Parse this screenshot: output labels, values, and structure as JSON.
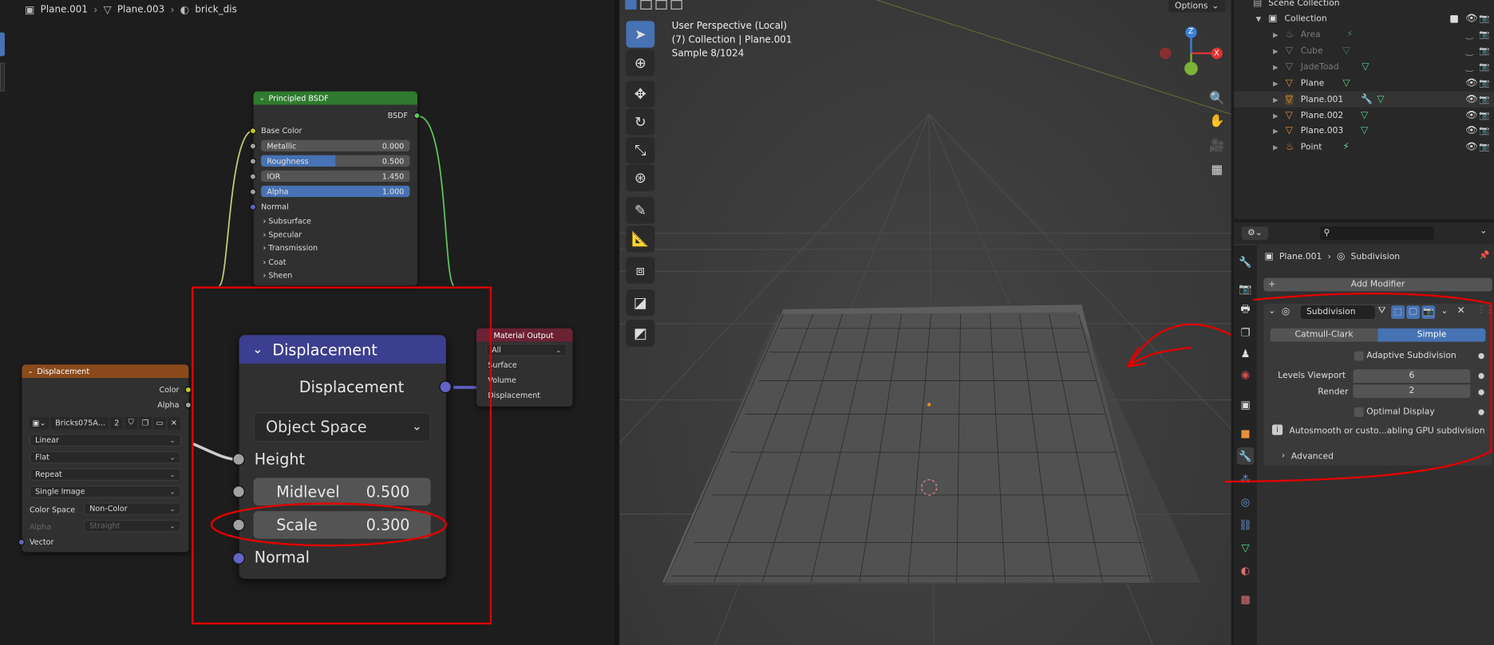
{
  "node_editor": {
    "breadcrumb": [
      "Plane.001",
      "Plane.003",
      "brick_dis"
    ],
    "principled": {
      "title": "Principled BSDF",
      "output": "BSDF",
      "base_color": "Base Color",
      "fields": [
        {
          "label": "Metallic",
          "value": "0.000",
          "fill": 0
        },
        {
          "label": "Roughness",
          "value": "0.500",
          "fill": 0.5
        },
        {
          "label": "IOR",
          "value": "1.450",
          "fill": 0
        },
        {
          "label": "Alpha",
          "value": "1.000",
          "fill": 1
        }
      ],
      "normal": "Normal",
      "panels": [
        "Subsurface",
        "Specular",
        "Transmission",
        "Coat",
        "Sheen"
      ]
    },
    "material_output": {
      "title": "Material Output",
      "target": "All",
      "inputs": [
        "Surface",
        "Volume",
        "Displacement"
      ]
    },
    "image_node": {
      "title": "Displacement",
      "outputs": [
        "Color",
        "Alpha"
      ],
      "image_name": "Bricks075A...",
      "users": "2",
      "interpolation": "Linear",
      "projection": "Flat",
      "extension": "Repeat",
      "source": "Single Image",
      "color_space_label": "Color Space",
      "color_space": "Non-Color",
      "alpha_label": "Alpha",
      "alpha_mode": "Straight",
      "vector": "Vector"
    },
    "displacement_zoom": {
      "title": "Displacement",
      "output": "Displacement",
      "space": "Object Space",
      "height": "Height",
      "midlevel_label": "Midlevel",
      "midlevel_value": "0.500",
      "scale_label": "Scale",
      "scale_value": "0.300",
      "normal": "Normal"
    }
  },
  "viewport": {
    "options": "Options",
    "line1": "User Perspective (Local)",
    "line2": "(7) Collection | Plane.001",
    "line3": "Sample 8/1024",
    "gizmo": {
      "z": "Z",
      "x": "X"
    }
  },
  "outliner": {
    "header": "Scene Collection",
    "collection": "Collection",
    "items": [
      {
        "name": "Area",
        "dim": true
      },
      {
        "name": "Cube",
        "dim": true
      },
      {
        "name": "JadeToad",
        "dim": true
      },
      {
        "name": "Plane",
        "dim": false
      },
      {
        "name": "Plane.001",
        "dim": false
      },
      {
        "name": "Plane.002",
        "dim": false
      },
      {
        "name": "Plane.003",
        "dim": false
      },
      {
        "name": "Point",
        "dim": false
      }
    ]
  },
  "properties": {
    "breadcrumb_object": "Plane.001",
    "breadcrumb_modifier": "Subdivision",
    "add_modifier": "Add Modifier",
    "modifier_name": "Subdivision",
    "mode_catmull": "Catmull-Clark",
    "mode_simple": "Simple",
    "adaptive": "Adaptive Subdivision",
    "levels_viewport_label": "Levels Viewport",
    "levels_viewport": "6",
    "render_label": "Render",
    "render_value": "2",
    "optimal_display": "Optimal Display",
    "warning": "Autosmooth or custo...abling GPU subdivision",
    "advanced": "Advanced"
  },
  "colors": {
    "accent": "#4772b3",
    "annotation": "#e00000",
    "principled_header": "#2f7a2f",
    "image_header": "#8a4a1c",
    "displacement_header": "#3c3f8f",
    "output_header": "#6b2233"
  }
}
